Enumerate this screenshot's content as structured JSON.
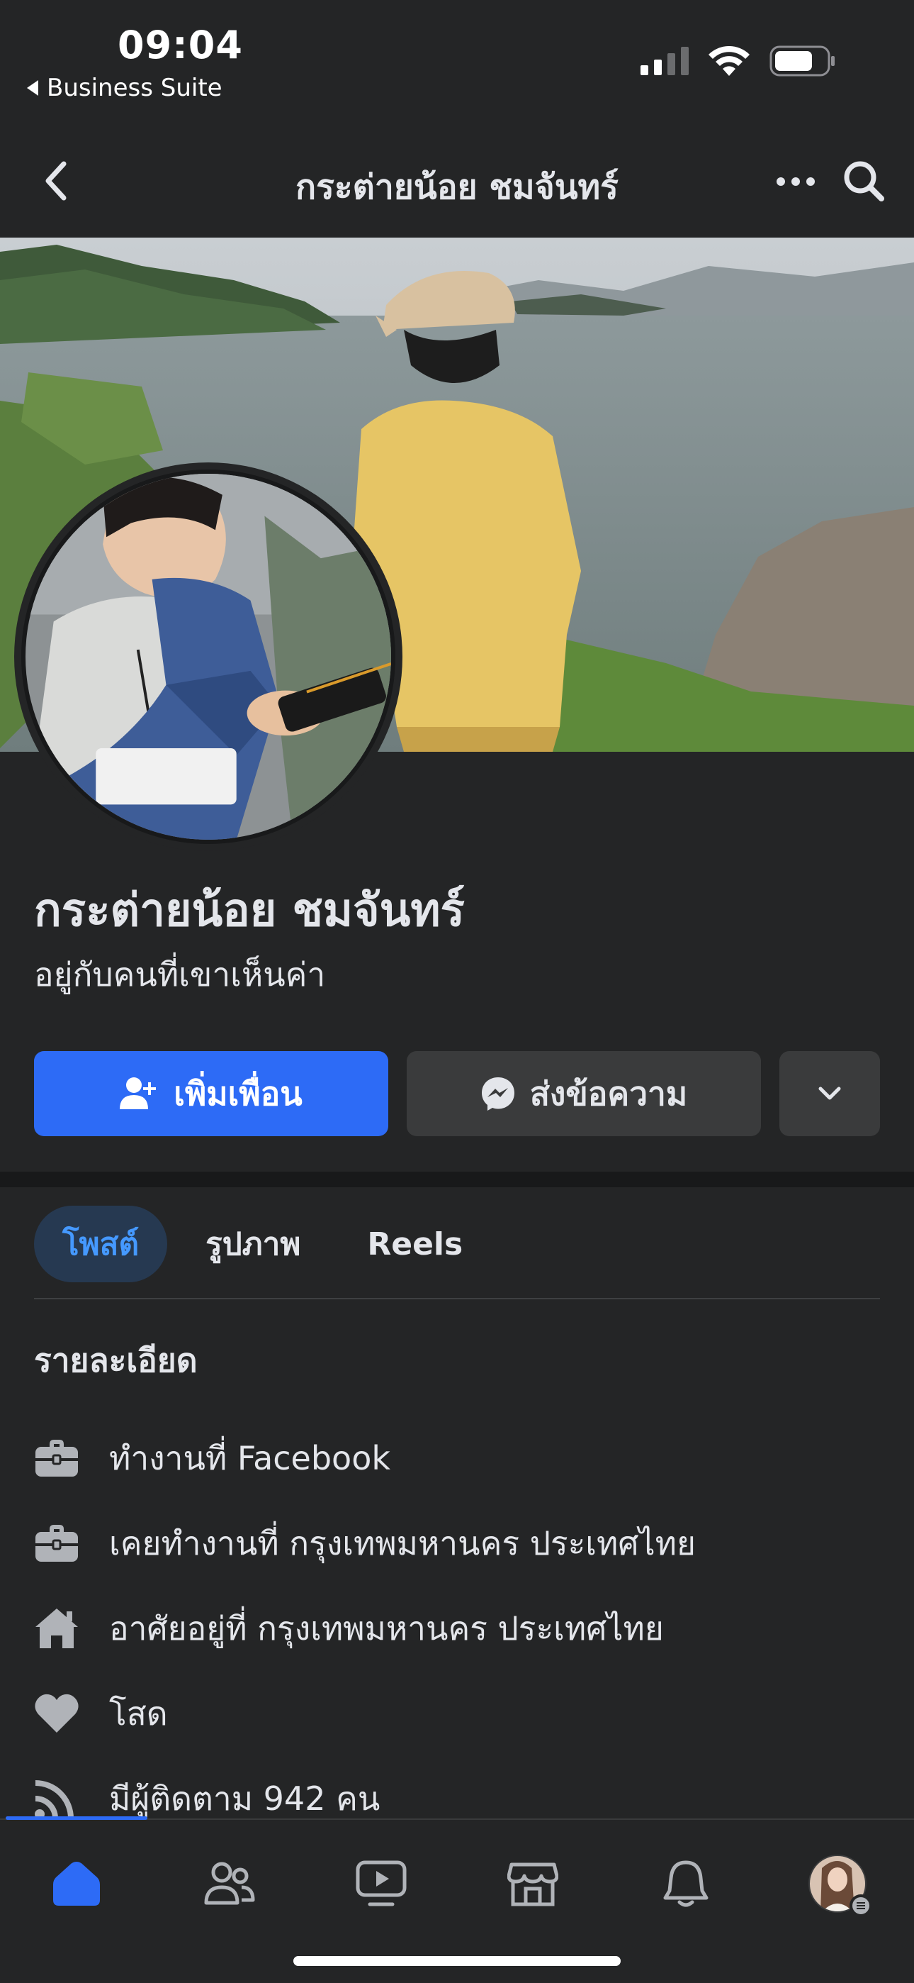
{
  "status_bar": {
    "time": "09:04",
    "back_app": "Business Suite"
  },
  "nav": {
    "title": "กระต่ายน้อย ชมจันทร์"
  },
  "profile": {
    "name": "กระต่ายน้อย ชมจันทร์",
    "bio": "อยู่กับคนที่เขาเห็นค่า"
  },
  "actions": {
    "add_friend": "เพิ่มเพื่อน",
    "message": "ส่งข้อความ"
  },
  "tabs": [
    {
      "label": "โพสต์",
      "active": true
    },
    {
      "label": "รูปภาพ",
      "active": false
    },
    {
      "label": "Reels",
      "active": false
    }
  ],
  "details": {
    "title": "รายละเอียด",
    "items": [
      {
        "icon": "briefcase-icon",
        "text": "ทำงานที่ Facebook"
      },
      {
        "icon": "briefcase-icon",
        "text": "เคยทำงานที่ กรุงเทพมหานคร ประเทศไทย"
      },
      {
        "icon": "home-icon",
        "text": "อาศัยอยู่ที่ กรุงเทพมหานคร ประเทศไทย"
      },
      {
        "icon": "heart-icon",
        "text": "โสด"
      },
      {
        "icon": "rss-icon",
        "text": "มีผู้ติดตาม 942 คน"
      }
    ]
  },
  "bottom_nav": [
    "home-icon",
    "friends-icon",
    "video-icon",
    "marketplace-icon",
    "bell-icon",
    "profile-avatar"
  ],
  "colors": {
    "background": "#242526",
    "primary_button": "#2d6bf6",
    "secondary_button": "#3a3b3c",
    "active_tab_bg": "#263951",
    "active_tab_text": "#4599ff"
  }
}
